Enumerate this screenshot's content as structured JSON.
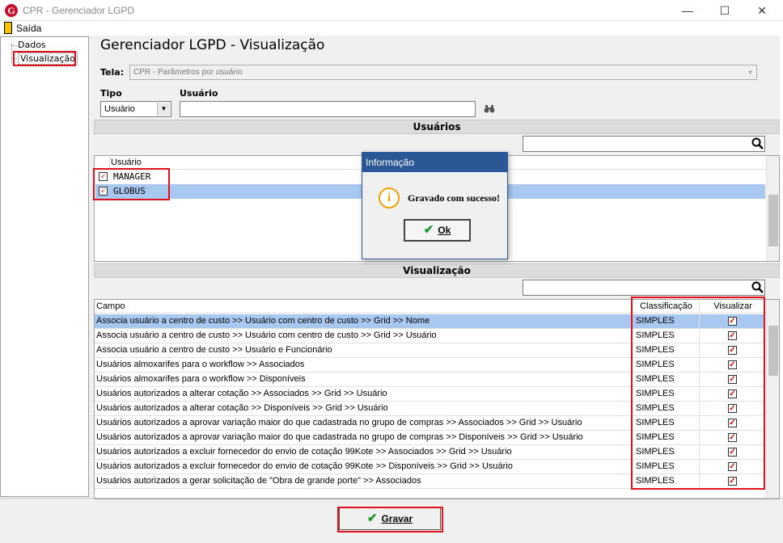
{
  "window": {
    "title": "CPR - Gerenciador LGPD",
    "app_icon_letter": "G",
    "min": "—",
    "max": "☐",
    "close": "✕"
  },
  "menu": {
    "exit_label": "Saída"
  },
  "tree": {
    "items": [
      "Dados",
      "Visualização"
    ]
  },
  "page": {
    "title": "Gerenciador LGPD - Visualização"
  },
  "form": {
    "tela_label": "Tela:",
    "tela_value": "CPR - Parâmetros por usuário",
    "tipo_label": "Tipo",
    "tipo_value": "Usuário",
    "usuario_label": "Usuário"
  },
  "users_section": {
    "header": "Usuários",
    "column": "Usuário",
    "rows": [
      {
        "name": "MANAGER",
        "checked": true
      },
      {
        "name": "GLOBUS",
        "checked": true
      }
    ]
  },
  "dialog": {
    "title": "Informação",
    "message": "Gravado com sucesso!",
    "ok": "Ok",
    "icon": "i"
  },
  "vis_section": {
    "header": "Visualização",
    "columns": [
      "Campo",
      "Classificação",
      "Visualizar"
    ],
    "rows": [
      {
        "campo": "Associa usuário a centro de custo >> Usuário com centro de custo >> Grid >> Nome",
        "classificacao": "SIMPLES",
        "visualizar": true
      },
      {
        "campo": "Associa usuário a centro de custo >> Usuário com centro de custo >> Grid >> Usuário",
        "classificacao": "SIMPLES",
        "visualizar": true
      },
      {
        "campo": "Associa usuário a centro de custo >> Usuário e Funcionário",
        "classificacao": "SIMPLES",
        "visualizar": true
      },
      {
        "campo": "Usuários almoxarifes para o workflow >> Associados",
        "classificacao": "SIMPLES",
        "visualizar": true
      },
      {
        "campo": "Usuários almoxarifes para o workflow >> Disponíveis",
        "classificacao": "SIMPLES",
        "visualizar": true
      },
      {
        "campo": "Usuários autorizados a alterar cotação >> Associados >> Grid >> Usuário",
        "classificacao": "SIMPLES",
        "visualizar": true
      },
      {
        "campo": "Usuários autorizados a alterar cotação >> Disponíveis >> Grid >> Usuário",
        "classificacao": "SIMPLES",
        "visualizar": true
      },
      {
        "campo": "Usuários autorizados a aprovar variação maior do que cadastrada no grupo de compras >> Associados >> Grid >> Usuário",
        "classificacao": "SIMPLES",
        "visualizar": true
      },
      {
        "campo": "Usuários autorizados a aprovar variação maior do que cadastrada no grupo de compras >> Disponíveis >> Grid >> Usuário",
        "classificacao": "SIMPLES",
        "visualizar": true
      },
      {
        "campo": "Usuários autorizados a excluir fornecedor do envio de cotação 99Kote >> Associados >> Grid >> Usuário",
        "classificacao": "SIMPLES",
        "visualizar": true
      },
      {
        "campo": "Usuários autorizados a excluir fornecedor do envio de cotação 99Kote >> Disponíveis >> Grid >> Usuário",
        "classificacao": "SIMPLES",
        "visualizar": true
      },
      {
        "campo": "Usuários autorizados a gerar solicitação de \"Obra de grande porte\" >> Associados",
        "classificacao": "SIMPLES",
        "visualizar": true
      }
    ]
  },
  "footer": {
    "gravar": "Gravar"
  },
  "colors": {
    "highlight": "#e0101c",
    "selection": "#a8c8f0",
    "dialog_title": "#2b5797",
    "check": "#1a9a2a"
  }
}
